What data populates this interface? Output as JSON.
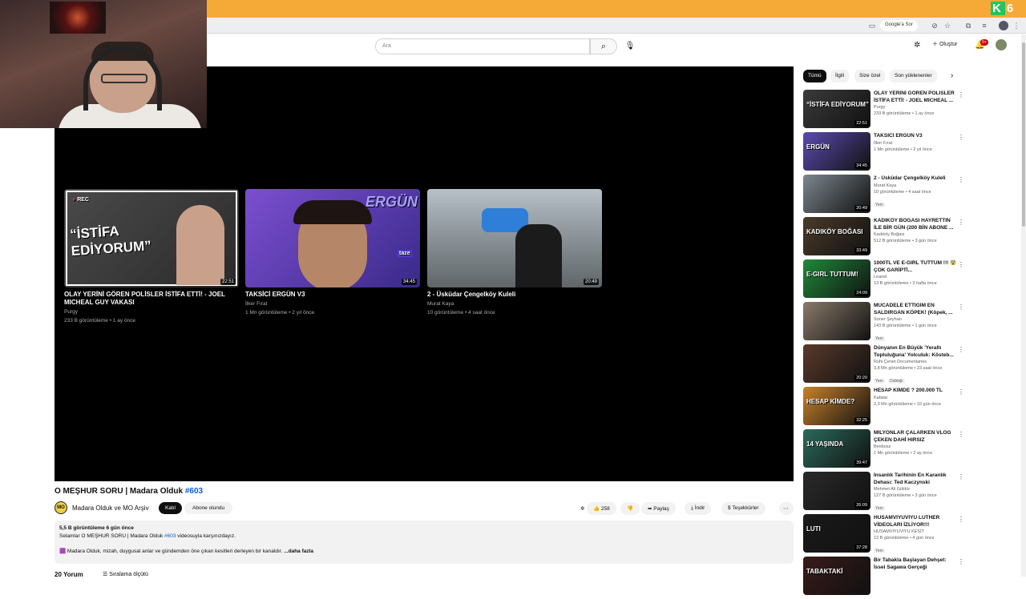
{
  "browser": {
    "google_chip": "Google'a Sor",
    "corner_logo": "K 6"
  },
  "header": {
    "search_placeholder": "Ara",
    "create_label": "Oluştur",
    "notif_count": "9+"
  },
  "end_cards": [
    {
      "title": "OLAY YERİNİ GÖREN POLİSLER İSTİFA ETTİ! - JOEL MICHEAL GUY VAKASI",
      "channel": "Purgy",
      "meta": "233 B görüntüleme • 1 ay önce",
      "duration": "22:51",
      "thumb_text": "“İSTİFA EDİYORUM”",
      "rec_label": "REC"
    },
    {
      "title": "TAKSİCİ ERGÜN V3",
      "channel": "İlker Fırat",
      "meta": "1 Mn görüntüleme • 2 yıl önce",
      "duration": "34:45",
      "thumb_text": "ERGÜN",
      "thumb_sub": "taze"
    },
    {
      "title": "2 - Üsküdar Çengelköy Kuleli",
      "channel": "Murat Kaya",
      "meta": "10 görüntüleme • 4 saat önce",
      "duration": "20:49"
    }
  ],
  "video": {
    "title": "O MEŞHUR SORU | Madara Olduk",
    "tag": "#603",
    "channel": "Madara Olduk ve MO Arşiv",
    "channel_avatar": "MO",
    "join_label": "Katıl",
    "subscribed_label": "Abone olundu",
    "likes": "258",
    "share_label": "Paylaş",
    "download_label": "İndir",
    "thanks_label": "Teşekkürler"
  },
  "description": {
    "stats": "5,5 B görüntüleme  6 gün önce",
    "line1_prefix": "Selamlar O MEŞHUR SORU | Madara Olduk ",
    "line1_tag": "#603",
    "line1_suffix": " videosuyla karşınızdayız.",
    "line2": "Madara Olduk, mizah, duygusal anlar ve gündemden öne çıkan kesitleri derleyen bir kanaldır.",
    "more": "...daha fazla"
  },
  "comments": {
    "count": "20 Yorum",
    "sort": "Sıralama ölçütü"
  },
  "chips": [
    "Tümü",
    "İlgili",
    "Size özel",
    "Son yüklenenler"
  ],
  "recommended": [
    {
      "title": "OLAY YERİNİ GÖREN POLİSLER İSTİFA ETTİ! - JOEL MICHEAL ...",
      "channel": "Purgy",
      "meta": "233 B görüntüleme • 1 ay önce",
      "duration": "22:51",
      "thumb_text": "“İSTİFA EDİYORUM”",
      "color": "#3b3b3b"
    },
    {
      "title": "TAKSİCİ ERGÜN V3",
      "channel": "İlker Fırat",
      "meta": "1 Mn görüntüleme • 2 yıl önce",
      "duration": "34:45",
      "thumb_text": "ERGÜN",
      "color": "#5b4bb0"
    },
    {
      "title": "2 - Üsküdar Çengelköy Kuleli",
      "channel": "Murat Kaya",
      "meta": "10 görüntüleme • 4 saat önce",
      "badge": "Yeni",
      "duration": "20:49",
      "thumb_text": "",
      "color": "#7d8790"
    },
    {
      "title": "KADIKÖY BOĞASI HAYRETTİN İLE BİR GÜN (200 BİN ABONE ...",
      "channel": "Kadıköy Boğası",
      "meta": "512 B görüntüleme • 3 gün önce",
      "duration": "33:49",
      "thumb_text": "KADIKÖY BOĞASI",
      "color": "#4a3a2a"
    },
    {
      "title": "1000TL VE E-GIRL TUTTUM !!! 😨 ÇOK GARİPTİ...",
      "channel": "Leanel",
      "meta": "13 B görüntüleme • 3 hafta önce",
      "duration": "24:09",
      "thumb_text": "E-GIRL TUTTUM!",
      "color": "#1f8a3a"
    },
    {
      "title": "MÜCADELE ETTİĞİM EN SALDIRGAN KÖPEK! (Köpek, ...",
      "channel": "Soner Şeyhan",
      "meta": "143 B görüntüleme • 1 gün önce",
      "badge": "Yeni",
      "duration": "",
      "thumb_text": "",
      "color": "#8a7a6a"
    },
    {
      "title": "Dünyanın En Büyük 'Yeraltı Topluluğuna' Yolculuk: Kösteb...",
      "channel": "Ruhi Çenet Documentaries",
      "meta": "3,8 Mn görüntüleme • 23 saat önce",
      "badge": "Yeni",
      "badge2": "Dublajlı",
      "duration": "20:20",
      "thumb_text": "",
      "color": "#5a3a2a"
    },
    {
      "title": "HESAP KİMDE ? 200.000 TL",
      "channel": "Kafalar",
      "meta": "2,3 Mn görüntüleme • 10 gün önce",
      "duration": "32:25",
      "thumb_text": "HESAP KİMDE?",
      "color": "#c9822a"
    },
    {
      "title": "MİLYONLAR ÇALARKEN VLOG ÇEKEN DAHİ HIRSIZ",
      "channel": "Beebosz",
      "meta": "1 Mn görüntüleme • 2 ay önce",
      "duration": "39:47",
      "thumb_text": "14 YAŞINDA",
      "color": "#2a6a5a"
    },
    {
      "title": "İnsanlık Tarihinin En Karanlık Dehası: Ted Kaczynski",
      "channel": "Mehmet Ali Güldür",
      "meta": "127 B görüntüleme • 3 gün önce",
      "badge": "Yeni",
      "duration": "26:09",
      "thumb_text": "",
      "color": "#2a2a2a"
    },
    {
      "title": "HUSAMVİYUVİYU LUTHER VİDEOLARI İZLİYOR!!!",
      "channel": "HUSAMVIYUVIYU KESİT",
      "meta": "13 B görüntüleme • 4 gün önce",
      "badge": "Yeni",
      "duration": "37:28",
      "thumb_text": "LUTI",
      "color": "#1a1a1a"
    },
    {
      "title": "Bir Tabakla Başlayan Dehşet: İssei Sagawa Gerçeği",
      "channel": "",
      "meta": "",
      "duration": "",
      "thumb_text": "TABAKTAKİ",
      "color": "#3a1a1a"
    }
  ]
}
